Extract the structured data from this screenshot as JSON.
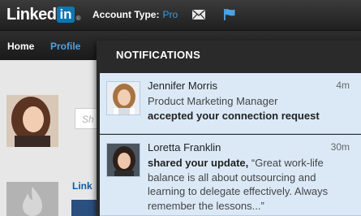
{
  "header": {
    "logo_text": "Linked",
    "logo_in": "in",
    "logo_reg": "®",
    "account_label": "Account Type:",
    "account_value": "Pro"
  },
  "nav": {
    "home": "Home",
    "profile": "Profile"
  },
  "background": {
    "search_placeholder": "Sh",
    "link_text": "Link"
  },
  "notifications": {
    "title": "NOTIFICATIONS",
    "items": [
      {
        "name": "Jennifer Morris",
        "time": "4m",
        "line1": "Product Marketing Manager",
        "line2": "accepted your connection request"
      },
      {
        "name": "Loretta Franklin",
        "time": "30m",
        "action": "shared your update,",
        "quote": "“Great work-life balance is all about outsourcing and learning to delegate effectively. Always remember the lessons...”"
      }
    ]
  },
  "colors": {
    "brand_blue": "#0b77b5",
    "link_blue": "#4aa3e8",
    "notification_bg": "#dbe9f7",
    "dropdown_bg": "#2a2a2a"
  },
  "icons": [
    "mail-icon",
    "flag-icon"
  ]
}
